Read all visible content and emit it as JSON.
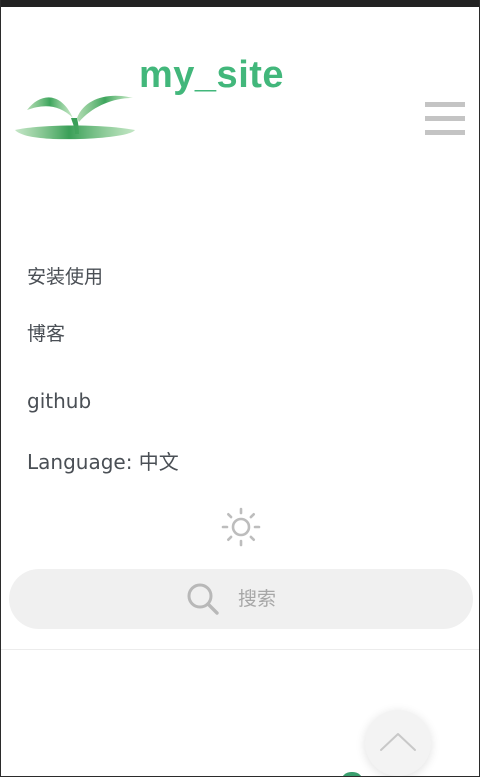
{
  "header": {
    "site_title": "my_site",
    "logo_icon": "sprout-logo-icon",
    "menu_icon": "hamburger-menu-icon"
  },
  "nav": {
    "items": [
      {
        "label": "安装使用"
      },
      {
        "label": "博客"
      },
      {
        "label": "github"
      },
      {
        "label": "Language: 中文"
      }
    ]
  },
  "theme_toggle": {
    "icon": "sun-icon"
  },
  "search": {
    "placeholder": "搜索",
    "icon": "search-icon"
  },
  "back_to_top": {
    "icon": "chevron-up-icon"
  },
  "colors": {
    "brand": "#42b77b",
    "text": "#4a4f55",
    "muted": "#a7a7a7",
    "search_bg": "#f0f0f0"
  }
}
